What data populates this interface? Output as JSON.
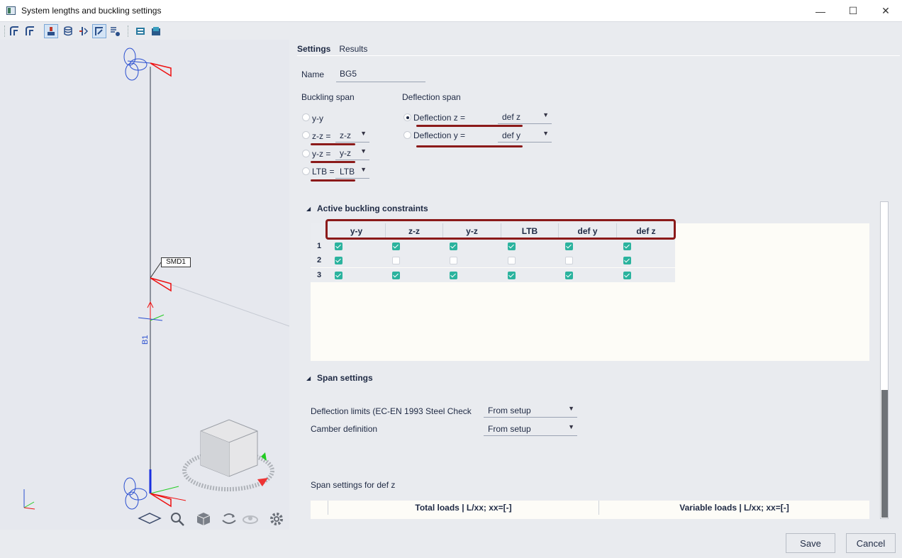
{
  "window": {
    "title": "System lengths and buckling settings",
    "minimize": "—",
    "maximize": "☐",
    "close": "✕"
  },
  "viewport": {
    "member_label": "B1",
    "node_label": "SMD1"
  },
  "tabs": [
    {
      "label": "Settings"
    },
    {
      "label": "Results"
    }
  ],
  "name": {
    "label": "Name",
    "value": "BG5"
  },
  "buckling_span": {
    "title": "Buckling span",
    "options": [
      {
        "label": "y-y",
        "value": ""
      },
      {
        "label": "z-z =",
        "value": "z-z"
      },
      {
        "label": "y-z =",
        "value": "y-z"
      },
      {
        "label": "LTB =",
        "value": "LTB"
      }
    ]
  },
  "deflection_span": {
    "title": "Deflection span",
    "options": [
      {
        "label": "Deflection z =",
        "value": "def z",
        "selected": true
      },
      {
        "label": "Deflection y =",
        "value": "def y",
        "selected": false
      }
    ]
  },
  "constraints": {
    "title": "Active buckling constraints",
    "columns": [
      "y-y",
      "z-z",
      "y-z",
      "LTB",
      "def y",
      "def z"
    ],
    "rows": [
      {
        "num": "1",
        "checks": [
          true,
          true,
          true,
          true,
          true,
          true
        ]
      },
      {
        "num": "2",
        "checks": [
          true,
          false,
          false,
          false,
          false,
          true
        ]
      },
      {
        "num": "3",
        "checks": [
          true,
          true,
          true,
          true,
          true,
          true
        ]
      }
    ]
  },
  "span_settings": {
    "title": "Span settings",
    "deflection_limits_label": "Deflection limits (EC-EN 1993 Steel Check",
    "deflection_limits_value": "From setup",
    "camber_label": "Camber definition",
    "camber_value": "From setup",
    "span_for_label": "Span settings for def z",
    "table_headers": [
      "Total loads | L/xx; xx=[-]",
      "Variable loads | L/xx; xx=[-]"
    ]
  },
  "footer": {
    "save": "Save",
    "cancel": "Cancel"
  },
  "colors": {
    "accent_red": "#8b1a1a",
    "check_teal": "#2bb39e"
  }
}
